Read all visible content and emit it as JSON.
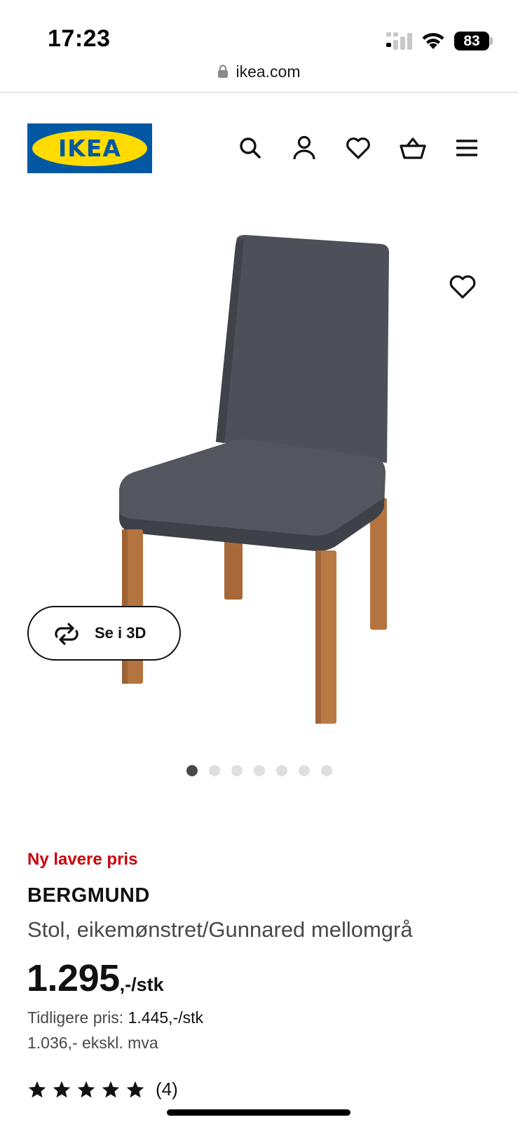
{
  "status_bar": {
    "time": "17:23",
    "battery": "83"
  },
  "browser": {
    "url": "ikea.com"
  },
  "header": {
    "logo_text": "IKEA",
    "icons": [
      "search-icon",
      "account-icon",
      "wishlist-icon",
      "cart-icon",
      "menu-icon"
    ]
  },
  "gallery": {
    "view_3d_label": "Se i 3D",
    "image_count": 7,
    "active_index": 0
  },
  "product": {
    "promo_label": "Ny lavere pris",
    "name": "BERGMUND",
    "description": "Stol, eikemønstret/Gunnared mellomgrå",
    "price": "1.295",
    "price_unit": ",-/stk",
    "previous_price_label": "Tidligere pris:",
    "previous_price": "1.445,-/stk",
    "price_ex_vat": "1.036,- ekskl. mva",
    "rating": 5,
    "review_count": "(4)"
  },
  "colors": {
    "ikea_blue": "#0058a3",
    "ikea_yellow": "#ffdb00",
    "promo_red": "#cc0008",
    "chair_fabric": "#4b4e56",
    "chair_wood": "#b5743f"
  }
}
